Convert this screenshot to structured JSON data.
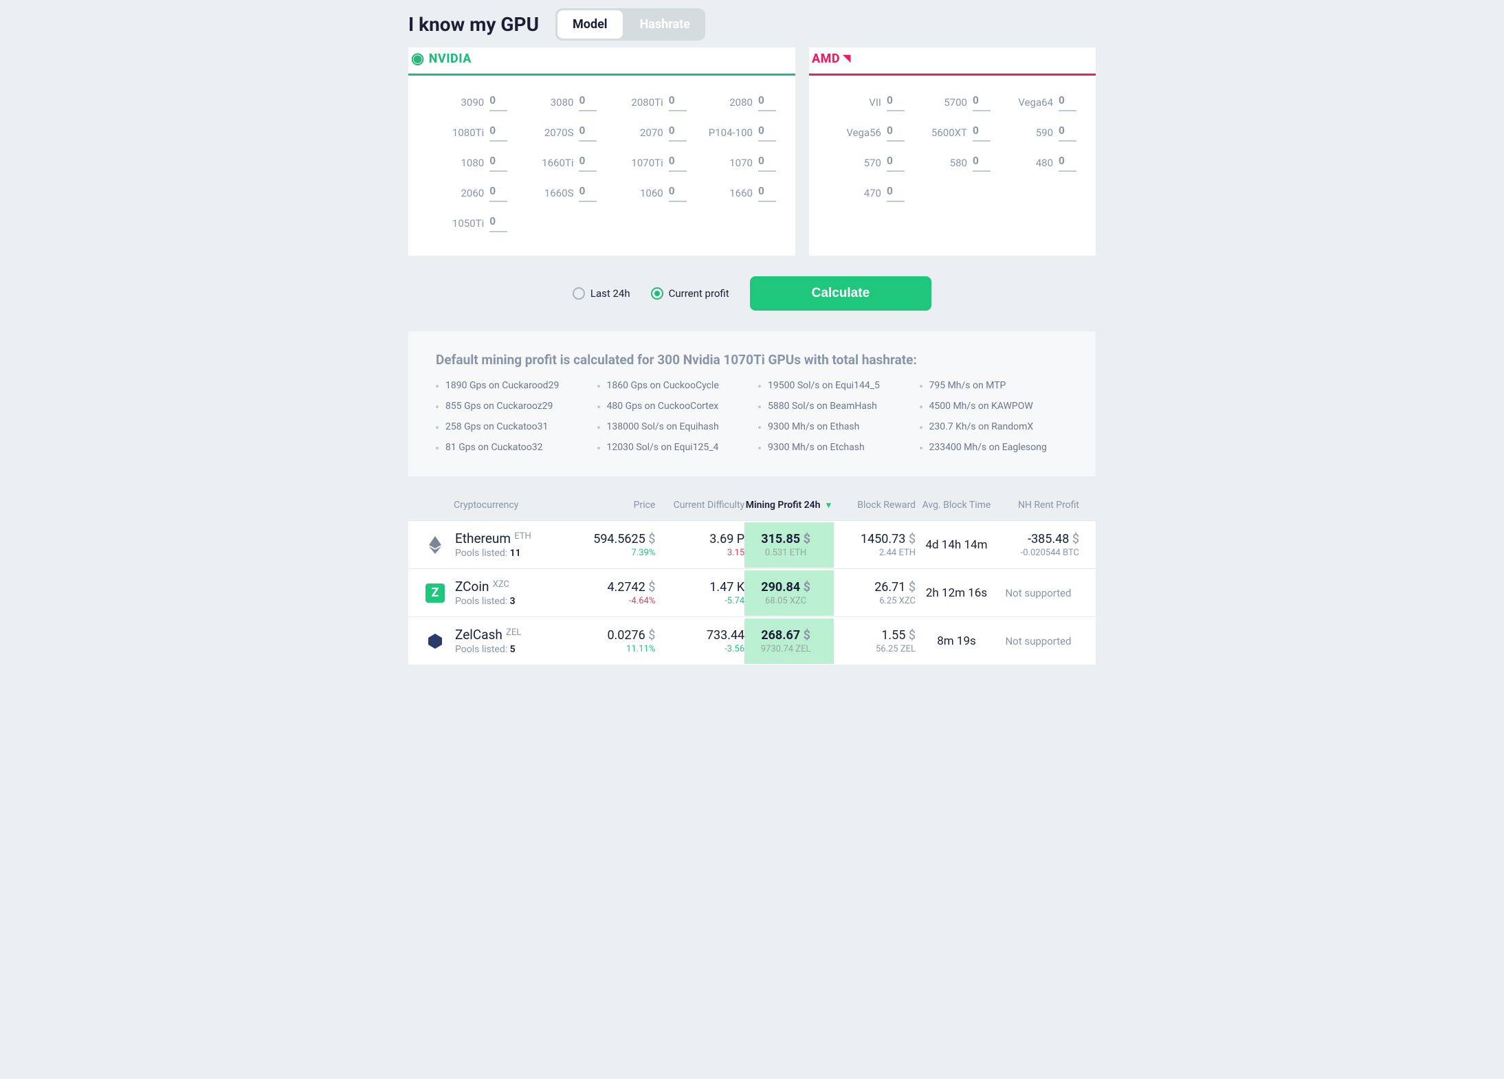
{
  "header": {
    "title": "I know my GPU",
    "toggle": {
      "model": "Model",
      "hashrate": "Hashrate"
    }
  },
  "brands": {
    "nvidia": "NVIDIA",
    "amd": "AMD"
  },
  "nvidia_gpus": [
    "3090",
    "3080",
    "2080Ti",
    "2080",
    "1080Ti",
    "2070S",
    "2070",
    "P104-100",
    "1080",
    "1660Ti",
    "1070Ti",
    "1070",
    "2060",
    "1660S",
    "1060",
    "1660",
    "1050Ti"
  ],
  "amd_gpus": [
    "VII",
    "5700",
    "Vega64",
    "Vega56",
    "5600XT",
    "590",
    "570",
    "580",
    "480",
    "470"
  ],
  "gpu_input_value": "0",
  "radios": {
    "last24h": "Last 24h",
    "current": "Current profit"
  },
  "calc_label": "Calculate",
  "default_box": {
    "heading": "Default mining profit is calculated for 300 Nvidia 1070Ti GPUs with total hashrate:",
    "items": [
      "1890 Gps on Cuckarood29",
      "1860 Gps on CuckooCycle",
      "19500 Sol/s on Equi144_5",
      "795 Mh/s on MTP",
      "855 Gps on Cuckarooz29",
      "480 Gps on CuckooCortex",
      "5880 Sol/s on BeamHash",
      "4500 Mh/s on KAWPOW",
      "258 Gps on Cuckatoo31",
      "138000 Sol/s on Equihash",
      "9300 Mh/s on Ethash",
      "230.7 Kh/s on RandomX",
      "81 Gps on Cuckatoo32",
      "12030 Sol/s on Equi125_4",
      "9300 Mh/s on Etchash",
      "233400 Mh/s on Eaglesong"
    ]
  },
  "table": {
    "headers": {
      "crypto": "Cryptocurrency",
      "price": "Price",
      "difficulty": "Current Difficulty",
      "profit": "Mining Profit 24h",
      "reward": "Block Reward",
      "blocktime": "Avg. Block Time",
      "rent": "NH Rent Profit"
    },
    "pools_label": "Pools listed: ",
    "usd": "$",
    "not_supported": "Not supported",
    "rows": [
      {
        "name": "Ethereum",
        "ticker": "ETH",
        "pools": "11",
        "price": "594.5625",
        "price_delta": "7.39%",
        "price_delta_cls": "green",
        "diff": "3.69 P",
        "diff_delta": "3.15",
        "diff_delta_cls": "red",
        "profit": "315.85",
        "profit_sub": "0.531 ETH",
        "reward": "1450.73",
        "reward_sub": "2.44 ETH",
        "blocktime": "4d 14h 14m",
        "rent_main": "-385.48",
        "rent_sub": "-0.020544 BTC",
        "rent_sub_cls": "gray",
        "rent_type": "value",
        "icon": "eth"
      },
      {
        "name": "ZCoin",
        "ticker": "XZC",
        "pools": "3",
        "price": "4.2742",
        "price_delta": "-4.64%",
        "price_delta_cls": "red",
        "diff": "1.47 K",
        "diff_delta": "-5.74",
        "diff_delta_cls": "green",
        "profit": "290.84",
        "profit_sub": "68.05 XZC",
        "reward": "26.71",
        "reward_sub": "6.25 XZC",
        "blocktime": "2h 12m 16s",
        "rent_type": "na",
        "icon": "xzc"
      },
      {
        "name": "ZelCash",
        "ticker": "ZEL",
        "pools": "5",
        "price": "0.0276",
        "price_delta": "11.11%",
        "price_delta_cls": "green",
        "diff": "733.44",
        "diff_delta": "-3.56",
        "diff_delta_cls": "green",
        "profit": "268.67",
        "profit_sub": "9730.74 ZEL",
        "reward": "1.55",
        "reward_sub": "56.25 ZEL",
        "blocktime": "8m 19s",
        "rent_type": "na",
        "icon": "zel"
      }
    ]
  }
}
